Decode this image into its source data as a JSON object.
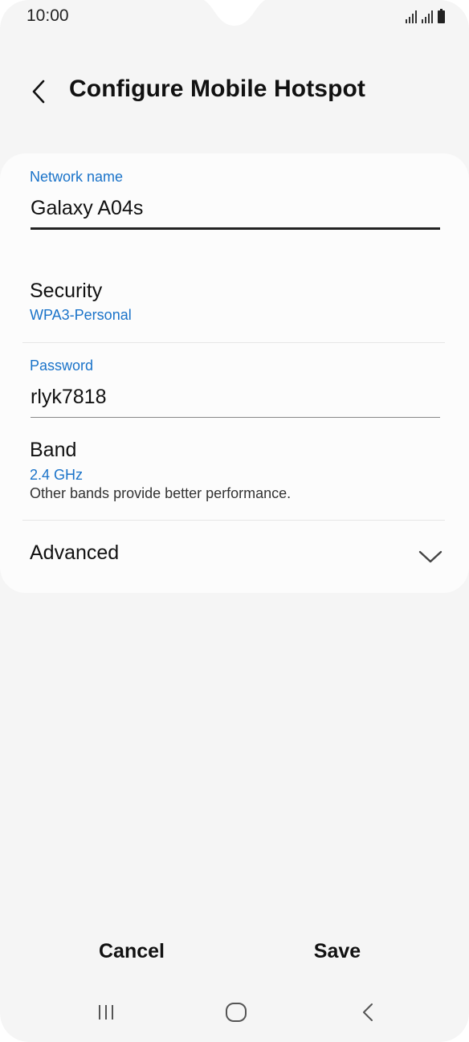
{
  "status_bar": {
    "time": "10:00"
  },
  "header": {
    "title": "Configure Mobile Hotspot"
  },
  "form": {
    "network_name": {
      "label": "Network name",
      "value": "Galaxy A04s"
    },
    "security": {
      "title": "Security",
      "value": "WPA3-Personal"
    },
    "password": {
      "label": "Password",
      "value": "rlyk7818"
    },
    "band": {
      "title": "Band",
      "value": "2.4 GHz",
      "hint": "Other bands provide better performance."
    },
    "advanced": {
      "title": "Advanced"
    }
  },
  "actions": {
    "cancel_label": "Cancel",
    "save_label": "Save"
  },
  "colors": {
    "accent": "#1a73c9",
    "background": "#f5f5f5",
    "card": "#fcfcfc",
    "text": "#111111"
  },
  "icons": {
    "back": "chevron-left-icon",
    "expand": "chevron-down-icon",
    "recents": "recents-icon",
    "home": "home-icon",
    "nav_back": "back-icon"
  }
}
